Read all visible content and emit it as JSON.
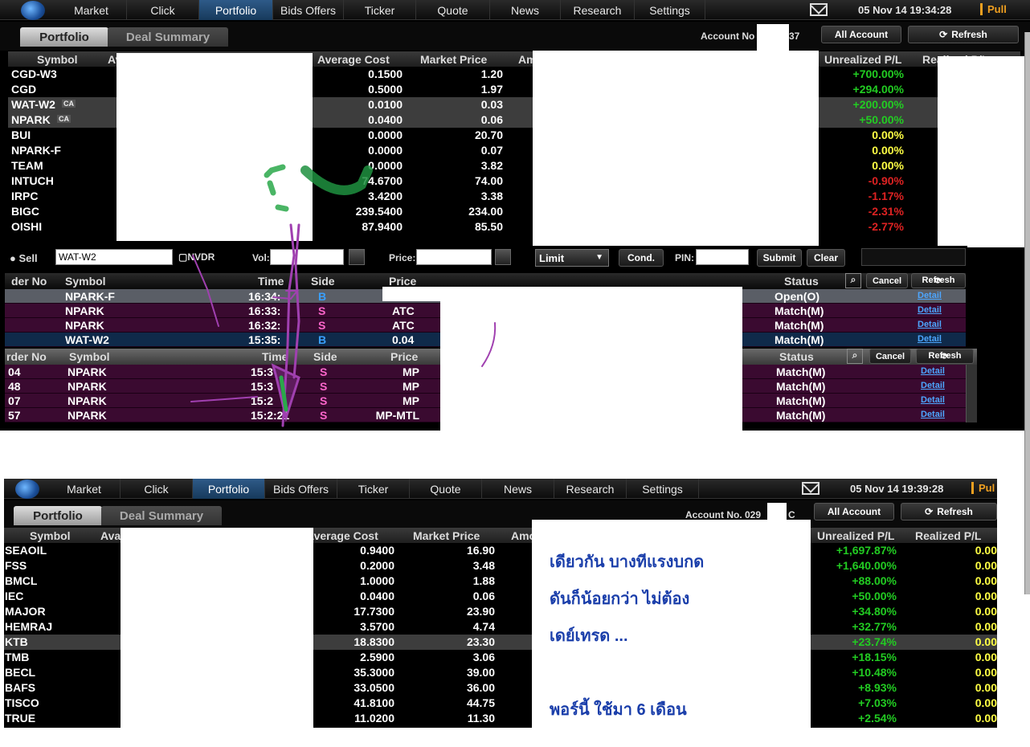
{
  "menu": [
    "Market",
    "Click",
    "Portfolio",
    "Bids Offers",
    "Ticker",
    "Quote",
    "News",
    "Research",
    "Settings"
  ],
  "colors": {
    "positive": "#22cc22",
    "zero": "#ffff44",
    "negative": "#dd2222",
    "accent": "#2e5a88",
    "pull": "#f0a020",
    "note": "#1a3eaa"
  },
  "top": {
    "datetime": "05 Nov 14  19:34:28",
    "pull": "Pull",
    "tab_portfolio": "Portfolio",
    "tab_deal": "Deal Summary",
    "account_label": "Account No",
    "account_suffix": "37",
    "all_account": "All Account",
    "refresh": "Refresh",
    "headers": {
      "symbol": "Symbol",
      "avg_partial": "Av",
      "avg_cost": "Average Cost",
      "market_price": "Market Price",
      "amt_partial": "Am",
      "unrealized": "Unrealized P/L",
      "realized_partial": "Realized P/L"
    },
    "rows": [
      {
        "symbol": "CGD-W3",
        "ca": "",
        "cost": "0.1500",
        "price": "1.20",
        "upl": "+700.00%",
        "cls": "pos"
      },
      {
        "symbol": "CGD",
        "ca": "",
        "cost": "0.5000",
        "price": "1.97",
        "upl": "+294.00%",
        "cls": "pos"
      },
      {
        "symbol": "WAT-W2",
        "ca": "CA",
        "cost": "0.0100",
        "price": "0.03",
        "upl": "+200.00%",
        "cls": "pos"
      },
      {
        "symbol": "NPARK",
        "ca": "CA",
        "cost": "0.0400",
        "price": "0.06",
        "upl": "+50.00%",
        "cls": "pos"
      },
      {
        "symbol": "BUI",
        "ca": "",
        "cost": "0.0000",
        "price": "20.70",
        "upl": "0.00%",
        "cls": "zero"
      },
      {
        "symbol": "NPARK-F",
        "ca": "",
        "cost": "0.0000",
        "price": "0.07",
        "upl": "0.00%",
        "cls": "zero"
      },
      {
        "symbol": "TEAM",
        "ca": "",
        "cost": "0.0000",
        "price": "3.82",
        "upl": "0.00%",
        "cls": "zero"
      },
      {
        "symbol": "INTUCH",
        "ca": "",
        "cost": "74.6700",
        "price": "74.00",
        "upl": "-0.90%",
        "cls": "neg"
      },
      {
        "symbol": "IRPC",
        "ca": "",
        "cost": "3.4200",
        "price": "3.38",
        "upl": "-1.17%",
        "cls": "neg"
      },
      {
        "symbol": "BIGC",
        "ca": "",
        "cost": "239.5400",
        "price": "234.00",
        "upl": "-2.31%",
        "cls": "neg"
      },
      {
        "symbol": "OISHI",
        "ca": "",
        "cost": "87.9400",
        "price": "85.50",
        "upl": "-2.77%",
        "cls": "neg"
      }
    ]
  },
  "order_entry": {
    "sell": "Sell",
    "symbol": "WAT-W2",
    "nvdr": "NVDR",
    "vol": "Vol:",
    "price": "Price:",
    "type": "Limit",
    "cond": "Cond.",
    "pin": "PIN:",
    "submit": "Submit",
    "clear": "Clear"
  },
  "orders1": {
    "headers": {
      "no": "der No",
      "symbol": "Symbol",
      "time": "Time",
      "side": "Side",
      "price": "Price",
      "status": "Status"
    },
    "cancel": "Cancel",
    "refresh": "Refresh",
    "rows": [
      {
        "symbol": "NPARK-F",
        "time": "16:34:",
        "side": "B",
        "price": "",
        "status": "Open(O)",
        "detail": "Detail"
      },
      {
        "symbol": "NPARK",
        "time": "16:33:",
        "side": "S",
        "price": "ATC",
        "status": "Match(M)",
        "detail": "Detail"
      },
      {
        "symbol": "NPARK",
        "time": "16:32:",
        "side": "S",
        "price": "ATC",
        "status": "Match(M)",
        "detail": "Detail"
      },
      {
        "symbol": "WAT-W2",
        "time": "15:35:",
        "side": "B",
        "price": "0.04",
        "status": "Match(M)",
        "detail": "Detail"
      }
    ]
  },
  "orders2": {
    "headers": {
      "no": "rder No",
      "symbol": "Symbol",
      "time": "Time",
      "side": "Side",
      "price": "Price",
      "status": "Status"
    },
    "cancel": "Cancel",
    "refresh": "Refresh",
    "rows": [
      {
        "no": "04",
        "symbol": "NPARK",
        "time": "15:3",
        "side": "S",
        "price": "MP",
        "status": "Match(M)",
        "detail": "Detail"
      },
      {
        "no": "48",
        "symbol": "NPARK",
        "time": "15:3",
        "side": "S",
        "price": "MP",
        "status": "Match(M)",
        "detail": "Detail"
      },
      {
        "no": "07",
        "symbol": "NPARK",
        "time": "15:2",
        "side": "S",
        "price": "MP",
        "status": "Match(M)",
        "detail": "Detail"
      },
      {
        "no": "57",
        "symbol": "NPARK",
        "time": "15:2:21",
        "side": "S",
        "price": "MP-MTL",
        "status": "Match(M)",
        "detail": "Detail"
      }
    ]
  },
  "bottom": {
    "datetime": "05 Nov 14  19:39:28",
    "pull": "Pul",
    "tab_portfolio": "Portfolio",
    "tab_deal": "Deal Summary",
    "account_label": "Account No. 029",
    "account_suffix": "C",
    "all_account": "All Account",
    "refresh": "Refresh",
    "headers": {
      "symbol": "Symbol",
      "avg_partial": "Ava",
      "avg_cost": "Average Cost",
      "market_price": "Market Price",
      "amt_partial": "Amo",
      "unrealized": "Unrealized P/L",
      "realized": "Realized P/L"
    },
    "rows": [
      {
        "symbol": "SEAOIL",
        "cost": "0.9400",
        "price": "16.90",
        "upl": "+1,697.87%",
        "rpl": "0.00"
      },
      {
        "symbol": "FSS",
        "cost": "0.2000",
        "price": "3.48",
        "upl": "+1,640.00%",
        "rpl": "0.00"
      },
      {
        "symbol": "BMCL",
        "cost": "1.0000",
        "price": "1.88",
        "upl": "+88.00%",
        "rpl": "0.00"
      },
      {
        "symbol": "IEC",
        "cost": "0.0400",
        "price": "0.06",
        "upl": "+50.00%",
        "rpl": "0.00"
      },
      {
        "symbol": "MAJOR",
        "cost": "17.7300",
        "price": "23.90",
        "upl": "+34.80%",
        "rpl": "0.00"
      },
      {
        "symbol": "HEMRAJ",
        "cost": "3.5700",
        "price": "4.74",
        "upl": "+32.77%",
        "rpl": "0.00"
      },
      {
        "symbol": "KTB",
        "cost": "18.8300",
        "price": "23.30",
        "upl": "+23.74%",
        "rpl": "0.00"
      },
      {
        "symbol": "TMB",
        "cost": "2.5900",
        "price": "3.06",
        "upl": "+18.15%",
        "rpl": "0.00"
      },
      {
        "symbol": "BECL",
        "cost": "35.3000",
        "price": "39.00",
        "upl": "+10.48%",
        "rpl": "0.00"
      },
      {
        "symbol": "BAFS",
        "cost": "33.0500",
        "price": "36.00",
        "upl": "+8.93%",
        "rpl": "0.00"
      },
      {
        "symbol": "TISCO",
        "cost": "41.8100",
        "price": "44.75",
        "upl": "+7.03%",
        "rpl": "0.00"
      },
      {
        "symbol": "TRUE",
        "cost": "11.0200",
        "price": "11.30",
        "upl": "+2.54%",
        "rpl": "0.00"
      }
    ]
  },
  "note": {
    "line1": "เดียวกัน      บางทีแรงบกด",
    "line2": "ดันก็น้อยกว่า    ไม่ต้อง",
    "line3": "เดย์เทรด    ...",
    "line4": "พอร์นี้    ใช้มา 6 เดือน"
  }
}
